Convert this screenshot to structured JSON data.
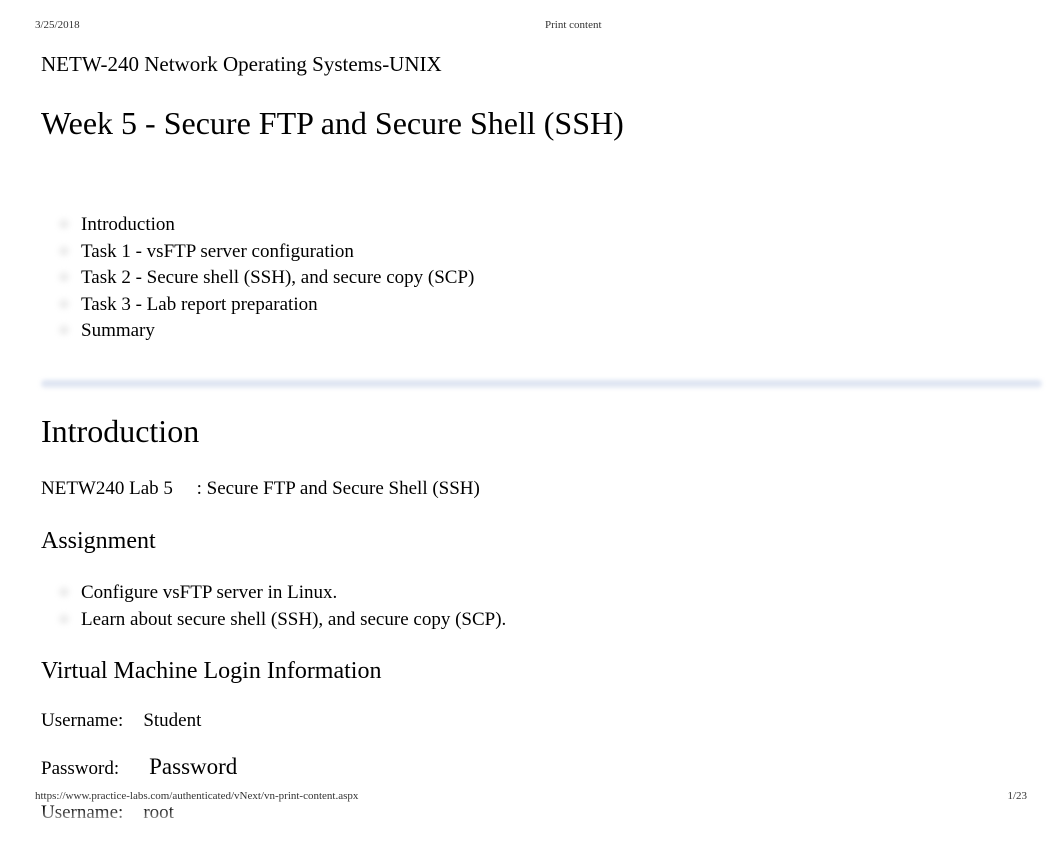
{
  "header": {
    "date": "3/25/2018",
    "title": "Print content"
  },
  "course": {
    "code": "NETW-240 Network Operating Systems-UNIX",
    "week": "Week 5 - Secure FTP and Secure Shell (SSH)"
  },
  "toc": [
    "Introduction",
    "Task 1 - vsFTP server configuration",
    "Task 2 - Secure shell (SSH), and secure copy (SCP)",
    "Task 3 - Lab report preparation",
    "Summary"
  ],
  "intro": {
    "heading": "Introduction",
    "lab_prefix": "NETW240 Lab 5",
    "lab_suffix": ": Secure FTP and Secure Shell (SSH)"
  },
  "assignment": {
    "heading": "Assignment",
    "items": [
      "Configure vsFTP server in Linux.",
      "Learn about secure shell (SSH), and secure copy (SCP)."
    ]
  },
  "vm": {
    "heading": "Virtual Machine Login Information",
    "username_label": "Username:",
    "username1": "Student",
    "password_label": "Password:",
    "password1": "Password",
    "username2": "root"
  },
  "footer": {
    "url": "https://www.practice-labs.com/authenticated/vNext/vn-print-content.aspx",
    "page": "1/23"
  }
}
